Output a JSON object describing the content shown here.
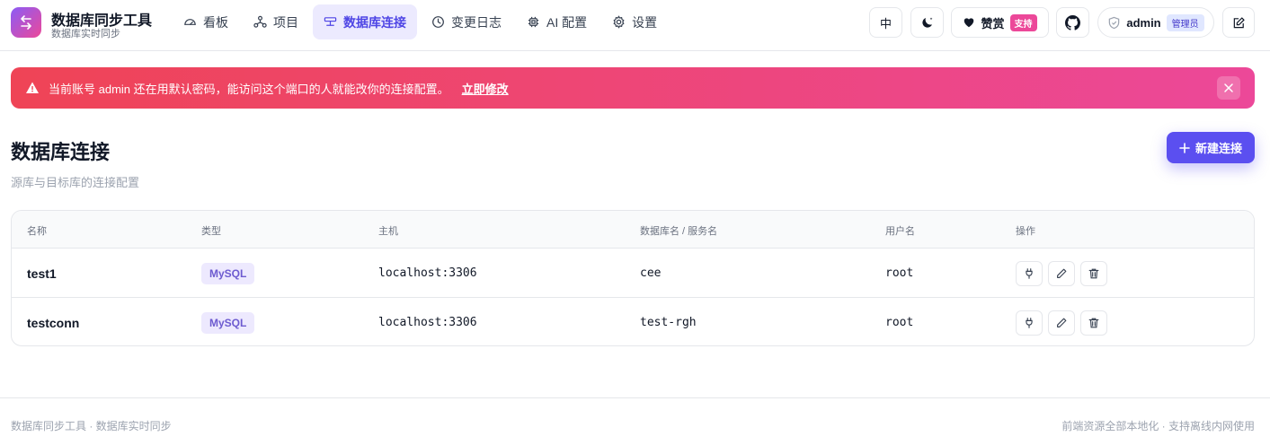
{
  "brand": {
    "title": "数据库同步工具",
    "subtitle": "数据库实时同步"
  },
  "nav": [
    {
      "label": "看板",
      "icon": "gauge-icon"
    },
    {
      "label": "项目",
      "icon": "hierarchy-icon"
    },
    {
      "label": "数据库连接",
      "icon": "connection-icon",
      "active": true
    },
    {
      "label": "变更日志",
      "icon": "clock-icon"
    },
    {
      "label": "AI 配置",
      "icon": "chip-icon"
    },
    {
      "label": "设置",
      "icon": "gear-icon"
    }
  ],
  "header_actions": {
    "language": "中",
    "donate_label": "赞赏",
    "donate_badge": "支持",
    "user_name": "admin",
    "user_role": "管理员"
  },
  "alert": {
    "message": "当前账号 admin 还在用默认密码，能访问这个端口的人就能改你的连接配置。",
    "link": "立即修改"
  },
  "page": {
    "title": "数据库连接",
    "subtitle": "源库与目标库的连接配置",
    "new_button": "新建连接"
  },
  "table": {
    "headers": {
      "name": "名称",
      "type": "类型",
      "host": "主机",
      "db": "数据库名 / 服务名",
      "user": "用户名",
      "actions": "操作"
    },
    "rows": [
      {
        "name": "test1",
        "type": "MySQL",
        "host": "localhost:3306",
        "db": "cee",
        "user": "root"
      },
      {
        "name": "testconn",
        "type": "MySQL",
        "host": "localhost:3306",
        "db": "test-rgh",
        "user": "root"
      }
    ]
  },
  "footer": {
    "left": "数据库同步工具 · 数据库实时同步",
    "right": "前端资源全部本地化 · 支持离线内网使用"
  },
  "colors": {
    "accent": "#5b4ff0",
    "alert_start": "#ef4456",
    "alert_end": "#ec4899",
    "badge_bg": "#ede9fe"
  }
}
